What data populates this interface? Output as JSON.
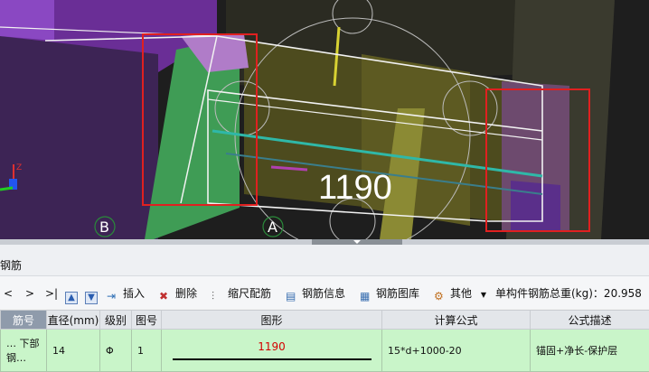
{
  "viewport": {
    "dimension_value": "1190",
    "axis_labels": [
      "B",
      "A"
    ],
    "coordinate_gizmo_label": "Z",
    "colors": {
      "highlight_box": "#e02020",
      "rebar_line": "#ffffff",
      "dimension_circle": "#bbbbbb"
    }
  },
  "panel": {
    "title": "钢筋",
    "toolbar": {
      "nav": [
        "<",
        ">",
        ">|"
      ],
      "insert": "插入",
      "delete": "删除",
      "scale_rebar": "缩尺配筋",
      "rebar_info": "钢筋信息",
      "rebar_library": "钢筋图库",
      "other": "其他",
      "total_weight_label": "单构件钢筋总重(kg)：20.958"
    },
    "table": {
      "headers": [
        "筋号",
        "直径(mm)",
        "级别",
        "图号",
        "图形",
        "计算公式",
        "公式描述"
      ],
      "rows": [
        {
          "name": "… 下部钢…",
          "diameter": "14",
          "grade": "Φ",
          "figure_no": "1",
          "figure_value": "1190",
          "formula": "15*d+1000-20",
          "description": "锚固+净长-保护层"
        }
      ]
    }
  }
}
